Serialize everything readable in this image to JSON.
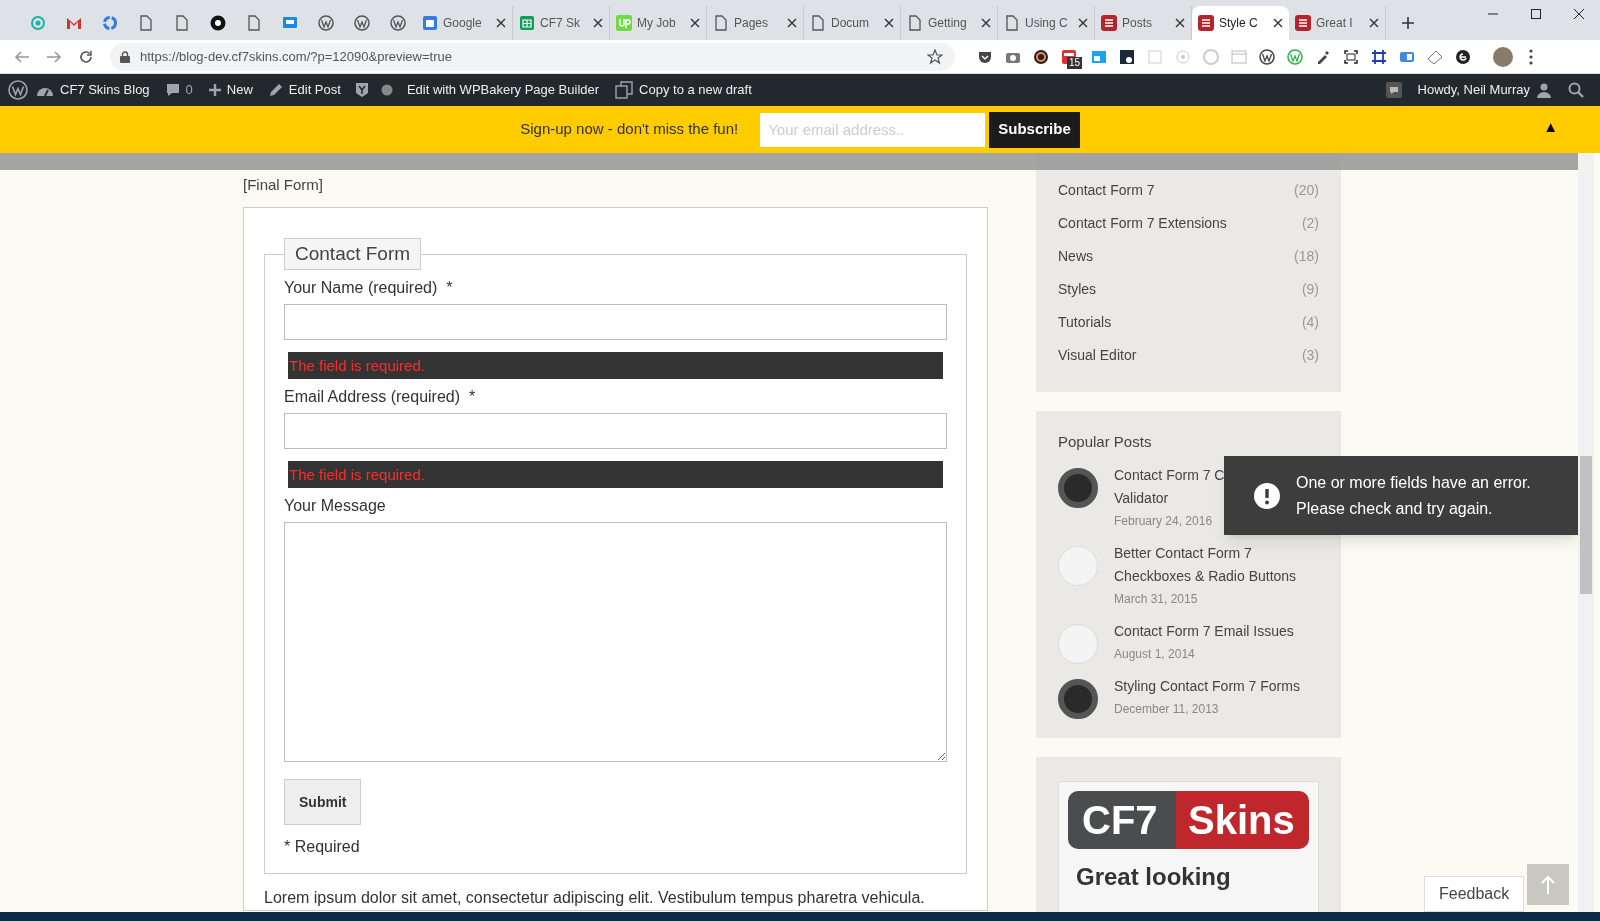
{
  "browser": {
    "pinned_tabs": [
      {
        "selected": false
      },
      {
        "selected": false
      },
      {
        "selected": false
      },
      {
        "selected": false
      },
      {
        "selected": false
      },
      {
        "selected": false
      },
      {
        "selected": false
      },
      {
        "selected": false
      },
      {
        "selected": false
      },
      {
        "selected": false
      },
      {
        "selected": false
      }
    ],
    "tabs": [
      {
        "label": "Google",
        "selected": false
      },
      {
        "label": "CF7 Sk",
        "selected": false
      },
      {
        "label": "My Job",
        "selected": false
      },
      {
        "label": "Pages",
        "selected": false
      },
      {
        "label": "Docum",
        "selected": false
      },
      {
        "label": "Getting",
        "selected": false
      },
      {
        "label": "Using C",
        "selected": false
      },
      {
        "label": "Posts",
        "selected": false
      },
      {
        "label": "Style C",
        "selected": true
      },
      {
        "label": "Great I",
        "selected": false
      }
    ],
    "url": "https://blog-dev.cf7skins.com/?p=12090&preview=true",
    "extension_badge": "15"
  },
  "admin_bar": {
    "site": "CF7 Skins Blog",
    "comments": "0",
    "new": "New",
    "edit": "Edit Post",
    "builder": "Edit with WPBakery Page Builder",
    "copy": "Copy to a new draft",
    "howdy": "Howdy, Neil Murray"
  },
  "signup_bar": {
    "text": "Sign-up now - don't miss the fun!",
    "email_placeholder": "Your email address..",
    "button": "Subscribe",
    "toggle": "▲"
  },
  "post": {
    "shortcode": "[Final Form]",
    "form": {
      "legend": "Contact Form",
      "fields": [
        {
          "kind": "text",
          "label": "Your Name (required)",
          "required_mark": "*",
          "error": "The field is required."
        },
        {
          "kind": "text",
          "label": "Email Address (required)",
          "required_mark": "*",
          "error": "The field is required."
        },
        {
          "kind": "textarea",
          "label": "Your Message"
        }
      ],
      "submit": "Submit",
      "footnote": "* Required"
    },
    "paragraph": "Lorem ipsum dolor sit amet, consectetur adipiscing elit. Vestibulum tempus pharetra vehicula."
  },
  "sidebar": {
    "categories": [
      {
        "name": "Contact Form 7",
        "count": "(20)"
      },
      {
        "name": "Contact Form 7 Extensions",
        "count": "(2)"
      },
      {
        "name": "News",
        "count": "(18)"
      },
      {
        "name": "Styles",
        "count": "(9)"
      },
      {
        "name": "Tutorials",
        "count": "(4)"
      },
      {
        "name": "Visual Editor",
        "count": "(3)"
      }
    ],
    "popular_posts": {
      "title": "Popular Posts",
      "items": [
        {
          "title_lines": [
            "Contact Form 7 C",
            "Validator"
          ],
          "date": "February 24, 2016"
        },
        {
          "title_lines": [
            "Better Contact Form 7",
            "Checkboxes & Radio Buttons"
          ],
          "date": "March 31, 2015"
        },
        {
          "title_lines": [
            "Contact Form 7 Email Issues"
          ],
          "date": "August 1, 2014"
        },
        {
          "title_lines": [
            "Styling Contact Form 7 Forms"
          ],
          "date": "December 11, 2013"
        }
      ]
    },
    "banner": {
      "logo_left": "CF7",
      "logo_right": "Skins",
      "tagline": "Great looking"
    }
  },
  "toast": {
    "message": "One or more fields have an error. Please check and try again."
  },
  "feedback": "Feedback"
}
